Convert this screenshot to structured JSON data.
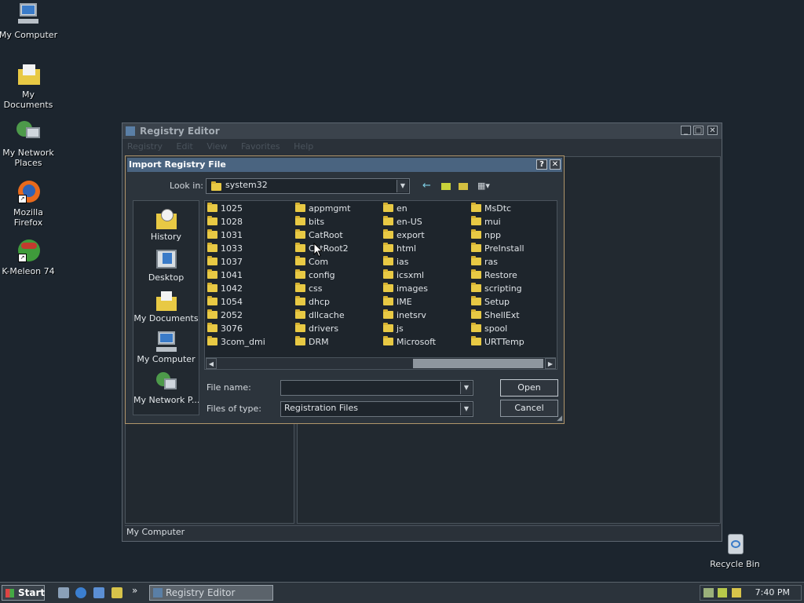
{
  "desktop": {
    "icons": [
      {
        "label": "My Computer"
      },
      {
        "label": "My Documents"
      },
      {
        "label": "My Network Places"
      },
      {
        "label": "Mozilla Firefox"
      },
      {
        "label": "K-Meleon 74"
      },
      {
        "label": "Recycle Bin"
      }
    ]
  },
  "regedit": {
    "title": "Registry Editor",
    "menu": [
      "Registry",
      "Edit",
      "View",
      "Favorites",
      "Help"
    ],
    "status": "My Computer"
  },
  "dialog": {
    "title": "Import Registry File",
    "help_btn": "?",
    "close_btn": "✕",
    "look_in_label": "Look in:",
    "look_in_value": "system32",
    "places": [
      "History",
      "Desktop",
      "My Documents",
      "My Computer",
      "My Network P..."
    ],
    "folders": [
      [
        "1025",
        "1028",
        "1031",
        "1033",
        "1037",
        "1041",
        "1042",
        "1054",
        "2052",
        "3076",
        "3com_dmi"
      ],
      [
        "appmgmt",
        "bits",
        "CatRoot",
        "CatRoot2",
        "Com",
        "config",
        "css",
        "dhcp",
        "dllcache",
        "drivers",
        "DRM"
      ],
      [
        "en",
        "en-US",
        "export",
        "html",
        "ias",
        "icsxml",
        "images",
        "IME",
        "inetsrv",
        "js",
        "Microsoft"
      ],
      [
        "MsDtc",
        "mui",
        "npp",
        "PreInstall",
        "ras",
        "Restore",
        "scripting",
        "Setup",
        "ShellExt",
        "spool",
        "URTTemp"
      ]
    ],
    "file_name_label": "File name:",
    "file_name_value": "",
    "files_of_type_label": "Files of type:",
    "files_of_type_value": "Registration Files",
    "open_label": "Open",
    "cancel_label": "Cancel"
  },
  "taskbar": {
    "start_label": "Start",
    "chevron": "»",
    "task_label": "Registry Editor",
    "clock": "7:40 PM"
  },
  "colors": {
    "desktop_bg": "#1c252e",
    "dialog_title_bg": "#4a6480",
    "folder": "#e8c944",
    "accent_border": "#b0956a"
  }
}
